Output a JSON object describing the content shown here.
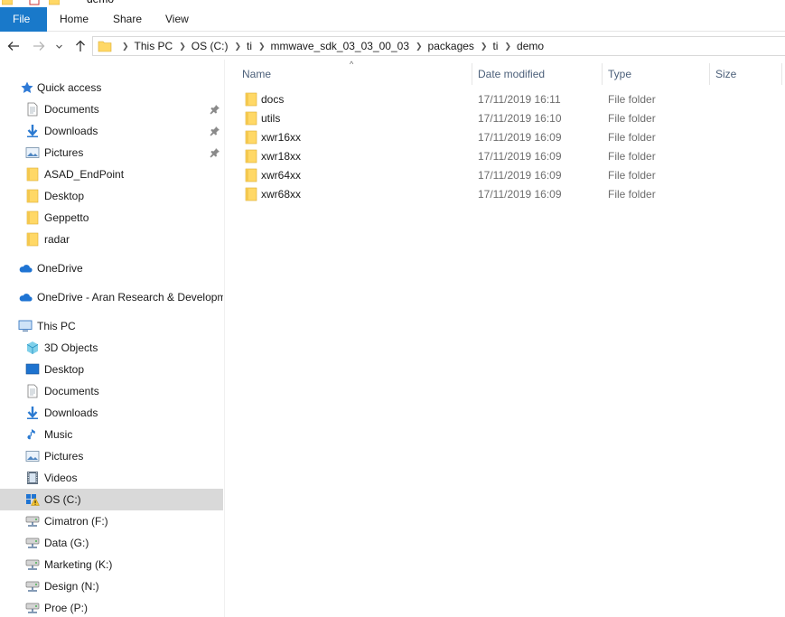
{
  "window": {
    "title": "demo"
  },
  "ribbon": {
    "tabs": [
      {
        "label": "File"
      },
      {
        "label": "Home"
      },
      {
        "label": "Share"
      },
      {
        "label": "View"
      }
    ]
  },
  "address": {
    "breadcrumb": [
      "This PC",
      "OS (C:)",
      "ti",
      "mmwave_sdk_03_03_00_03",
      "packages",
      "ti",
      "demo"
    ]
  },
  "nav": {
    "quick_access": "Quick access",
    "qa_items": [
      "Documents",
      "Downloads",
      "Pictures",
      "ASAD_EndPoint",
      "Desktop",
      "Geppetto",
      "radar"
    ],
    "onedrive": "OneDrive",
    "onedrive_org": "OneDrive - Aran Research & Developm",
    "this_pc": "This PC",
    "pc_items": [
      "3D Objects",
      "Desktop",
      "Documents",
      "Downloads",
      "Music",
      "Pictures",
      "Videos",
      "OS (C:)",
      "Cimatron (F:)",
      "Data (G:)",
      "Marketing (K:)",
      "Design (N:)",
      "Proe (P:)"
    ]
  },
  "columns": {
    "name": "Name",
    "date": "Date modified",
    "type": "Type",
    "size": "Size"
  },
  "files": [
    {
      "name": "docs",
      "date": "17/11/2019 16:11",
      "type": "File folder"
    },
    {
      "name": "utils",
      "date": "17/11/2019 16:10",
      "type": "File folder"
    },
    {
      "name": "xwr16xx",
      "date": "17/11/2019 16:09",
      "type": "File folder"
    },
    {
      "name": "xwr18xx",
      "date": "17/11/2019 16:09",
      "type": "File folder"
    },
    {
      "name": "xwr64xx",
      "date": "17/11/2019 16:09",
      "type": "File folder"
    },
    {
      "name": "xwr68xx",
      "date": "17/11/2019 16:09",
      "type": "File folder"
    }
  ],
  "colors": {
    "accent": "#1979ca",
    "folder": "#ffd866",
    "selected": "#d9d9d9",
    "header_text": "#4c607a"
  }
}
